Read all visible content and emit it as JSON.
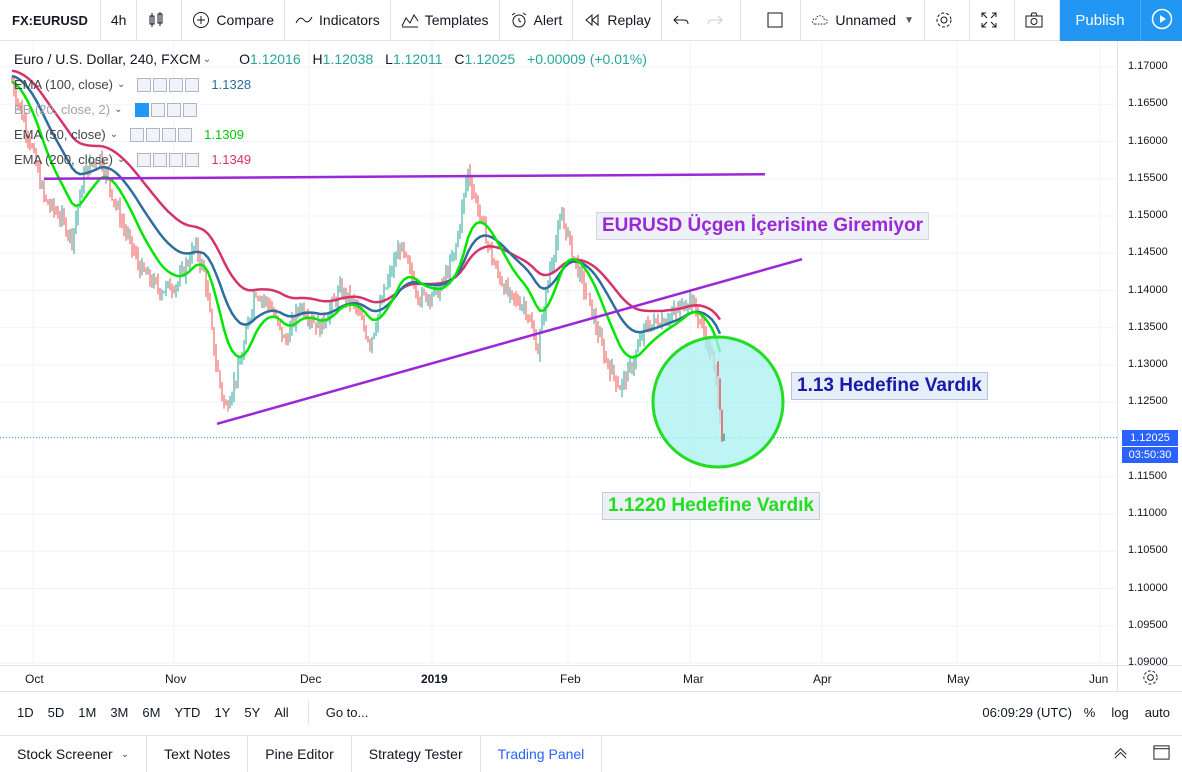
{
  "toolbar": {
    "symbol": "FX:EURUSD",
    "interval": "4h",
    "compare": "Compare",
    "indicators": "Indicators",
    "templates": "Templates",
    "alert": "Alert",
    "replay": "Replay",
    "layout_name": "Unnamed",
    "publish": "Publish"
  },
  "legend": {
    "title": "Euro / U.S. Dollar, 240, FXCM",
    "open_label": "O",
    "open": "1.12016",
    "high_label": "H",
    "high": "1.12038",
    "low_label": "L",
    "low": "1.12011",
    "close_label": "C",
    "close": "1.12025",
    "change": "+0.00009 (+0.01%)"
  },
  "indicators": [
    {
      "label": "EMA (100, close)",
      "value": "1.1328",
      "color": "#2f6e9c"
    },
    {
      "label": "BB (20, close, 2)",
      "value": "",
      "color": "#7fb3e0"
    },
    {
      "label": "EMA (50, close)",
      "value": "1.1309",
      "color": "#00e600"
    },
    {
      "label": "EMA (200, close)",
      "value": "1.1349",
      "color": "#d6336c"
    }
  ],
  "annotations": {
    "title": "EURUSD Üçgen İçerisine Giremiyor",
    "target1": "1.13 Hedefine Vardık",
    "target2": "1.1220 Hedefine Vardık"
  },
  "price_axis": {
    "ticks": [
      "1.17000",
      "1.16500",
      "1.16000",
      "1.15500",
      "1.15000",
      "1.14500",
      "1.14000",
      "1.13500",
      "1.13000",
      "1.12500",
      "1.11500",
      "1.11000",
      "1.10500",
      "1.10000",
      "1.09500",
      "1.09000"
    ],
    "tick_values": [
      1.17,
      1.165,
      1.16,
      1.155,
      1.15,
      1.145,
      1.14,
      1.135,
      1.13,
      1.125,
      1.115,
      1.11,
      1.105,
      1.1,
      1.095,
      1.09
    ],
    "current_price": "1.12025",
    "current_value": 1.12025,
    "countdown": "03:50:30"
  },
  "time_axis": [
    "Oct",
    "Nov",
    "Dec",
    "2019",
    "Feb",
    "Mar",
    "Apr",
    "May",
    "Jun"
  ],
  "range_bar": {
    "ranges": [
      "1D",
      "5D",
      "1M",
      "3M",
      "6M",
      "YTD",
      "1Y",
      "5Y",
      "All"
    ],
    "goto": "Go to...",
    "clock": "06:09:29 (UTC)",
    "percent": "%",
    "log": "log",
    "auto": "auto"
  },
  "bottom_tabs": [
    "Stock Screener",
    "Text Notes",
    "Pine Editor",
    "Strategy Tester",
    "Trading Panel"
  ],
  "colors": {
    "accent": "#2196f3",
    "up": "#26a69a",
    "down": "#ef5350",
    "trendline": "#9c27d6",
    "circle_fill": "#a8f0f0",
    "circle_stroke": "#22dd22"
  }
}
